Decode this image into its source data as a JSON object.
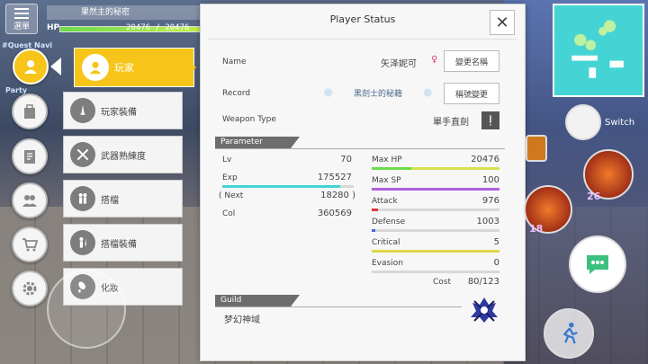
{
  "colors": {
    "accent_yellow": "#f7c51a",
    "hp_green": "#6bdc4a",
    "exp_cyan": "#42d4d4",
    "maxhp_bar": "#d6e24a",
    "sp_bar": "#b060e0",
    "attack_bar": "#e03a3a",
    "defense_bar": "#4a6ae0",
    "critical_bar": "#e0d84a"
  },
  "hud": {
    "menu_label": "選單",
    "player_title": "果然主的秘密",
    "hp_label": "HP",
    "hp_value": "20476 / 20476",
    "hp_fraction": 1.0,
    "quest_label": "#Quest Navi",
    "party_label": "Party"
  },
  "left_menu": [
    {
      "name": "player",
      "icon": "player-icon"
    },
    {
      "name": "bag",
      "icon": "bag-icon"
    },
    {
      "name": "quest-log",
      "icon": "notebook-icon"
    },
    {
      "name": "friends",
      "icon": "friends-icon"
    },
    {
      "name": "shop",
      "icon": "cart-icon"
    },
    {
      "name": "settings",
      "icon": "gear-icon"
    }
  ],
  "submenu": {
    "active_label": "玩家",
    "items": [
      {
        "label": "玩家裝備",
        "icon": "equipment-icon"
      },
      {
        "label": "武器熟練度",
        "icon": "crossed-swords-icon"
      },
      {
        "label": "搭檔",
        "icon": "partner-icon"
      },
      {
        "label": "搭檔裝備",
        "icon": "partner-equipment-icon"
      },
      {
        "label": "化妝",
        "icon": "makeup-icon"
      }
    ]
  },
  "panel": {
    "title": "Player Status",
    "close_icon": "close-icon",
    "name_label": "Name",
    "name_value": "矢泽妮可",
    "gender_symbol": "♀",
    "rename_button": "變更名稱",
    "record_label": "Record",
    "record_value": "黑劍士的秘籍",
    "record_button": "稱號變更",
    "weapon_label": "Weapon Type",
    "weapon_value": "單手直劍",
    "weapon_icon": "sword-icon",
    "parameter_header": "Parameter",
    "left_stats": [
      {
        "label": "Lv",
        "value": "70"
      },
      {
        "label": "Exp",
        "value": "175527",
        "bar_fraction": 0.9
      },
      {
        "label": "( Next",
        "value": "18280 )"
      },
      {
        "label": "Col",
        "value": "360569"
      }
    ],
    "right_stats": [
      {
        "label": "Max HP",
        "value": "20476",
        "bar_fraction": 0.31,
        "bar_color": "#d6e24a",
        "lead_color": "#6bdc4a"
      },
      {
        "label": "Max SP",
        "value": "100",
        "bar_fraction": 1.0,
        "bar_color": "#b060e0"
      },
      {
        "label": "Attack",
        "value": "976",
        "bar_fraction": 0.05,
        "bar_color": "#e03a3a"
      },
      {
        "label": "Defense",
        "value": "1003",
        "bar_fraction": 0.03,
        "bar_color": "#4a6ae0"
      },
      {
        "label": "Critical",
        "value": "5",
        "bar_fraction": 1.0,
        "bar_color": "#e0d84a"
      },
      {
        "label": "Evasion",
        "value": "0",
        "bar_fraction": 0.0,
        "bar_color": "#cccccc"
      }
    ],
    "cost_label": "Cost",
    "cost_value": "80/123",
    "guild_header": "Guild",
    "guild_name": "梦幻神域",
    "guild_emblem": "guild-emblem-icon"
  },
  "right_hud": {
    "switch_label": "Switch",
    "skill_count_1": "26",
    "skill_count_2": "18",
    "chat_icon": "chat-icon",
    "run_icon": "run-icon"
  }
}
